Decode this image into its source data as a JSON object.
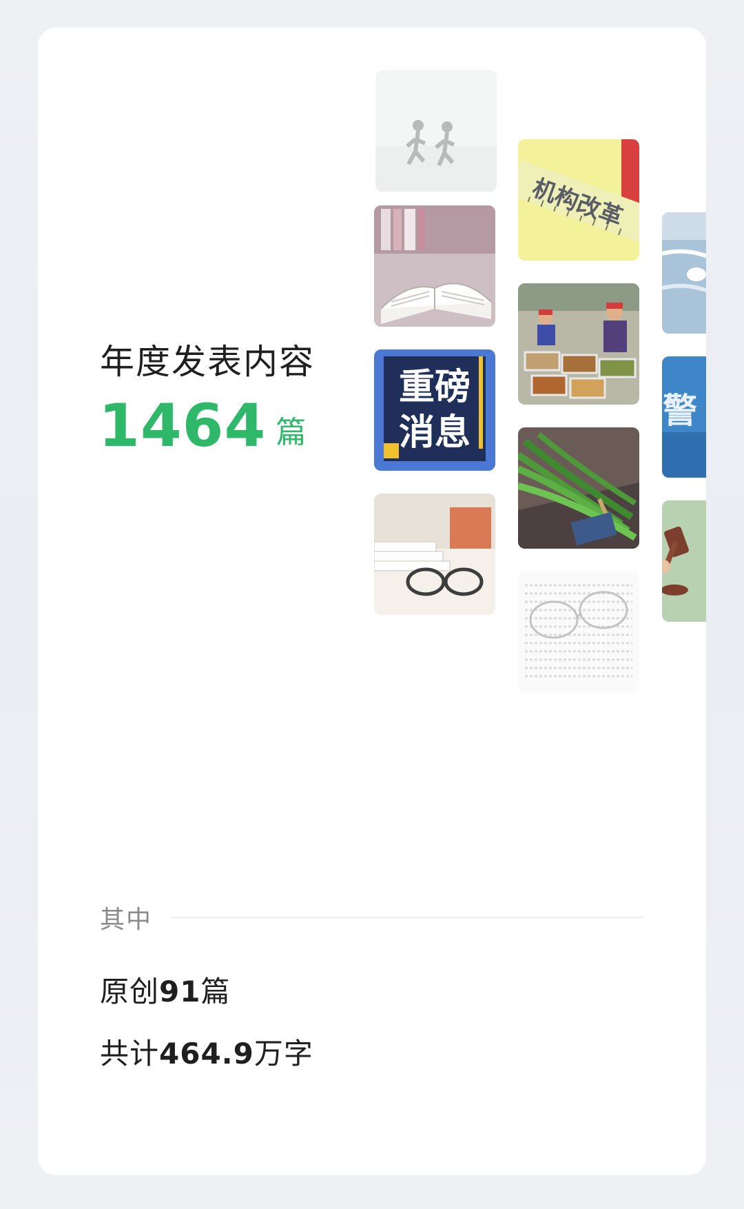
{
  "summary": {
    "headline": "年度发表内容",
    "count": "1464",
    "count_unit": "篇"
  },
  "thumbnails": [
    {
      "icon": "runners-photo"
    },
    {
      "icon": "institutional-reform-ruler",
      "text": "机构改革"
    },
    {
      "icon": "open-book-photo"
    },
    {
      "icon": "canteen-food-photo"
    },
    {
      "icon": "water-photo"
    },
    {
      "icon": "breaking-news-badge",
      "text_line1": "重磅",
      "text_line2": "消息"
    },
    {
      "icon": "vegetable-bundle-photo"
    },
    {
      "icon": "police-badge",
      "text": "警"
    },
    {
      "icon": "books-glasses-photo"
    },
    {
      "icon": "gavel-photo"
    },
    {
      "icon": "newspaper-glasses-photo"
    }
  ],
  "details": {
    "section_label": "其中",
    "original_prefix": "原创",
    "original_count": "91",
    "original_suffix": "篇",
    "total_prefix": "共计",
    "total_words": "464.9",
    "total_suffix": "万字"
  },
  "colors": {
    "accent": "#2fb86a",
    "text": "#1f1f1f",
    "muted": "#8a8a8a"
  }
}
